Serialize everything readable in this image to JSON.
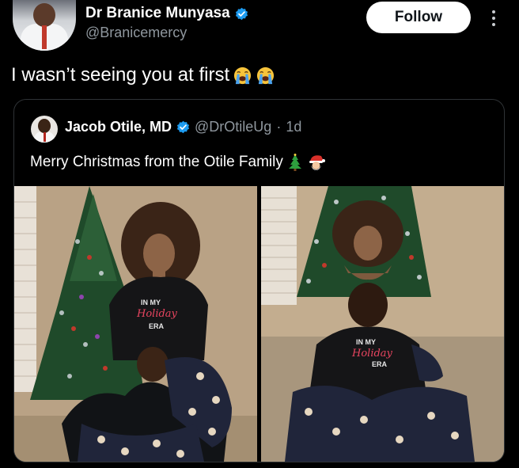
{
  "author": {
    "name": "Dr Branice Munyasa",
    "handle": "@Branicemercy"
  },
  "actions": {
    "follow_label": "Follow",
    "more_icon": "more-vertical-icon"
  },
  "post": {
    "text": "I wasn’t seeing you at first",
    "emojis": [
      "loudly-crying-face-icon",
      "loudly-crying-face-icon"
    ]
  },
  "quote": {
    "name": "Jacob Otile, MD",
    "handle": "@DrOtileUg",
    "separator": "·",
    "time": "1d",
    "text": "Merry Christmas from the Otile Family",
    "emojis": [
      "christmas-tree-icon",
      "santa-icon"
    ],
    "photos": [
      {
        "shirt_line1": "IN MY",
        "shirt_line2": "Holiday",
        "shirt_line3": "ERA"
      },
      {
        "shirt_line1": "IN MY",
        "shirt_line2": "Holiday",
        "shirt_line3": "ERA"
      }
    ]
  },
  "colors": {
    "background": "#000000",
    "text": "#e7e9ea",
    "muted": "#8f979e",
    "verified": "#1d9bf0",
    "border": "#2f3336"
  }
}
